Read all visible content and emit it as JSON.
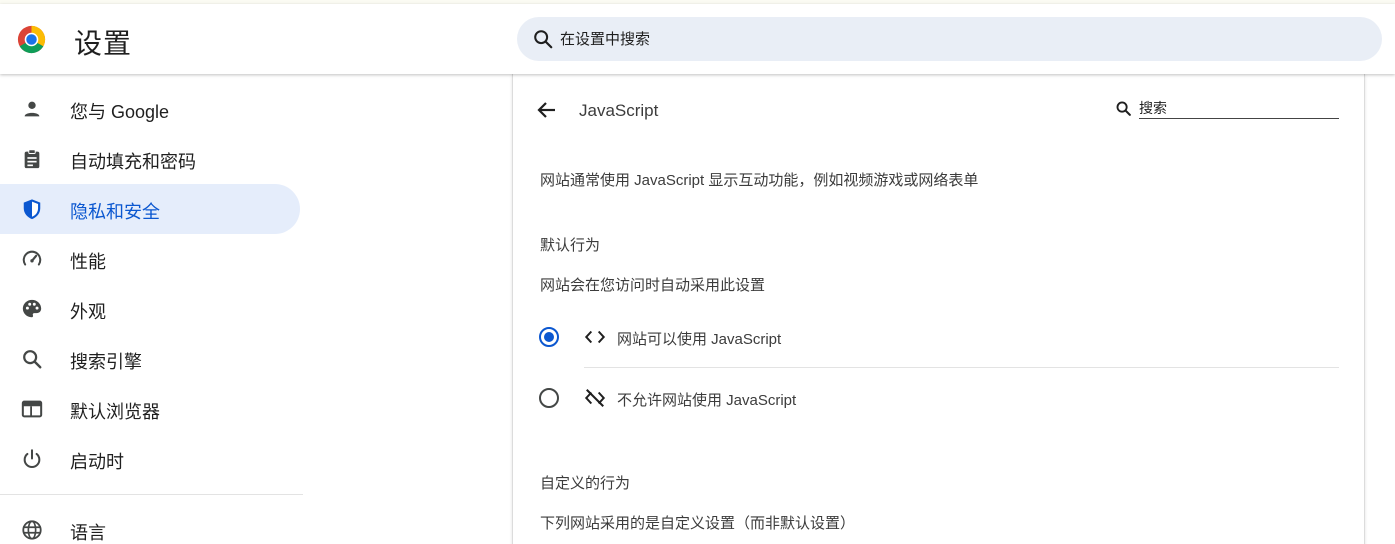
{
  "header": {
    "title": "设置",
    "search_placeholder": "在设置中搜索"
  },
  "sidebar": {
    "items": [
      {
        "label": "您与 Google",
        "icon": "person-icon"
      },
      {
        "label": "自动填充和密码",
        "icon": "clipboard-icon"
      },
      {
        "label": "隐私和安全",
        "icon": "shield-icon",
        "active": true
      },
      {
        "label": "性能",
        "icon": "speedometer-icon"
      },
      {
        "label": "外观",
        "icon": "palette-icon"
      },
      {
        "label": "搜索引擎",
        "icon": "search-icon"
      },
      {
        "label": "默认浏览器",
        "icon": "browser-window-icon"
      },
      {
        "label": "启动时",
        "icon": "power-icon"
      },
      {
        "label": "语言",
        "icon": "globe-icon"
      }
    ]
  },
  "page": {
    "title": "JavaScript",
    "search_placeholder": "搜索",
    "description": "网站通常使用 JavaScript 显示互动功能，例如视频游戏或网络表单",
    "default_behavior": {
      "heading": "默认行为",
      "subtitle": "网站会在您访问时自动采用此设置",
      "options": [
        {
          "label": "网站可以使用 JavaScript",
          "icon": "code-icon",
          "checked": true
        },
        {
          "label": "不允许网站使用 JavaScript",
          "icon": "code-off-icon",
          "checked": false
        }
      ]
    },
    "custom_behavior": {
      "heading": "自定义的行为",
      "subtitle": "下列网站采用的是自定义设置（而非默认设置）"
    }
  },
  "colors": {
    "accent": "#0b57d0",
    "active_nav_bg": "#e5edfb",
    "search_bg": "#e9eef6"
  }
}
